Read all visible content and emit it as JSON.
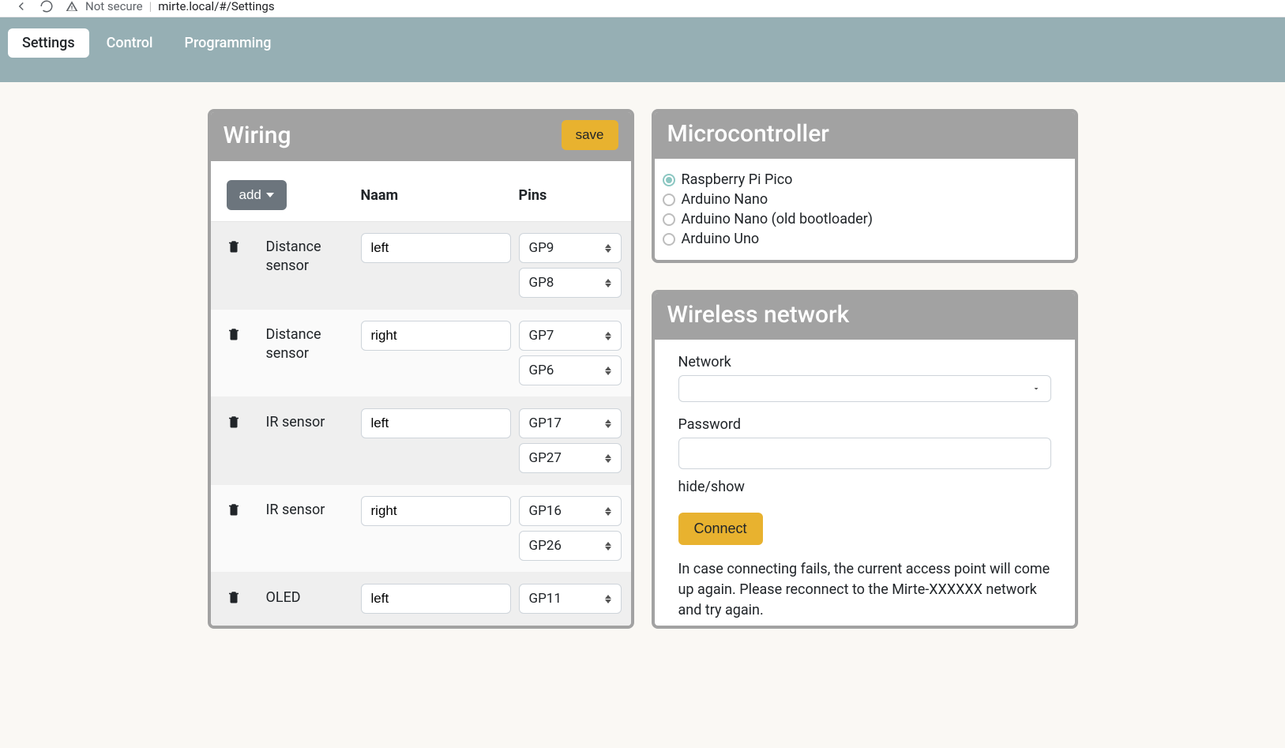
{
  "browser": {
    "not_secure": "Not secure",
    "url": "mirte.local/#/Settings"
  },
  "tabs": {
    "settings": "Settings",
    "control": "Control",
    "programming": "Programming"
  },
  "wiring": {
    "title": "Wiring",
    "save_label": "save",
    "add_label": "add",
    "col_naam": "Naam",
    "col_pins": "Pins",
    "rows": [
      {
        "type": "Distance sensor",
        "name": "left",
        "pins": [
          "GP9",
          "GP8"
        ]
      },
      {
        "type": "Distance sensor",
        "name": "right",
        "pins": [
          "GP7",
          "GP6"
        ]
      },
      {
        "type": "IR sensor",
        "name": "left",
        "pins": [
          "GP17",
          "GP27"
        ]
      },
      {
        "type": "IR sensor",
        "name": "right",
        "pins": [
          "GP16",
          "GP26"
        ]
      },
      {
        "type": "OLED",
        "name": "left",
        "pins": [
          "GP11"
        ]
      }
    ]
  },
  "microcontroller": {
    "title": "Microcontroller",
    "options": [
      "Raspberry Pi Pico",
      "Arduino Nano",
      "Arduino Nano (old bootloader)",
      "Arduino Uno"
    ],
    "selected_index": 0
  },
  "wireless": {
    "title": "Wireless network",
    "network_label": "Network",
    "password_label": "Password",
    "hide_show": "hide/show",
    "connect_label": "Connect",
    "hint": "In case connecting fails, the current access point will come up again. Please reconnect to the Mirte-XXXXXX network and try again."
  }
}
